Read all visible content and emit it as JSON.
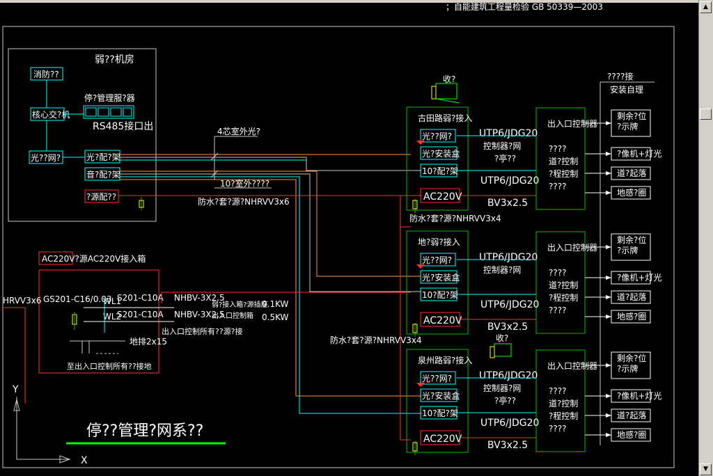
{
  "header_note": "；自能建筑工程量检验    GB  50339—2003",
  "server_room": {
    "title": "弱??机房",
    "fire": "消防??",
    "core_switch": "核心交?机",
    "mgmt_label": "停?管理服?器",
    "rs485": "RS485接口出",
    "optical": "光??网?",
    "odf": "光?配?架",
    "audio": "音?配?架",
    "power": "?源配??"
  },
  "cables": {
    "outdoor_fiber": "4芯室外光?",
    "outdoor_copper": "10?室外????",
    "nhrvv_1": "防水?套?源?NHRVV3x6",
    "nhrvv_2": "防水?套?源?NHRVV3x4",
    "nhrvv_3": "防水?套?源?NHRVV3x4"
  },
  "power_panel": {
    "title": "AC220V?源AC220V接入箱",
    "in": "HRVV3x6",
    "main_breaker": "GS201-C16/0.03",
    "b1": "S201-C10A",
    "b2": "S201-C10A",
    "w1": "WL1",
    "w2": "WL2",
    "cable1": "NHBV-3X2.5",
    "cable2": "NHBV-3X2.5",
    "load1": "弱?接入箱?源插座",
    "load2": "出入口控制箱",
    "kw1": "0.1KW",
    "kw2": "0.5KW",
    "note": "出入口控制所有??源?接",
    "ground": "地排2x15",
    "ground_note": "至出入口控制所有??接地"
  },
  "title": "停??管理?网系??",
  "axis": {
    "y": "Y",
    "x": "X"
  },
  "terminal_label": "收?",
  "top_right": {
    "label1": "????接",
    "label2": "安装自理"
  },
  "stations": [
    {
      "name": "古田路弱?接入",
      "media": "光??网?",
      "box": "光?安装盒",
      "patch": "10?配?架",
      "ac": "AC220V",
      "utp1": "UTP6/JDG20",
      "ctrl_net": "控制器?网",
      "sub": "?亭??",
      "utp2": "UTP6/JDG20",
      "bv": "BV3x2.5",
      "controller": "出入口控制器",
      "q1": "????",
      "q2": "道?控制",
      "q3": "?程控制",
      "q4": "????",
      "dev1": "剩余?位\n?示牌",
      "dev2": "?像机+灯光",
      "dev3": "道?起落",
      "dev4": "地感?圈"
    },
    {
      "name": "地?弱?接入",
      "media": "光??网?",
      "box": "光?安装盒",
      "patch": "10?配?架",
      "ac": "AC220V",
      "utp1": "UTP6/JDG20",
      "ctrl_net": "控制器?网",
      "sub": "",
      "utp2": "UTP6/JDG20",
      "bv": "BV3x2.5",
      "controller": "出入口控制器",
      "q1": "????",
      "q2": "道?控制",
      "q3": "?程控制",
      "q4": "????",
      "dev1": "剩余?位\n?示牌",
      "dev2": "?像机+灯光",
      "dev3": "道?起落",
      "dev4": "地感?圈"
    },
    {
      "name": "泉州路弱?接入",
      "media": "光??网?",
      "box": "光?安装盒",
      "patch": "10?配?架",
      "ac": "AC220V",
      "utp1": "UTP6/JDG20",
      "ctrl_net": "控制器?网",
      "sub": "?亭??",
      "utp2": "UTP6/JDG20",
      "bv": "BV3x2.5",
      "controller": "出入口控制器",
      "q1": "????",
      "q2": "道?控制",
      "q3": "?程控制",
      "q4": "????",
      "dev1": "剩余?位\n?示牌",
      "dev2": "?像机+灯光",
      "dev3": "道?起落",
      "dev4": "地感?圈"
    }
  ],
  "colors": {
    "frame": "#c8c8c8",
    "cyan": "#00ffff",
    "red": "#ff3030",
    "green": "#00c000",
    "yellow": "#ffff00",
    "orange": "#ff9a3c",
    "white_line": "#c8c8c8",
    "title_underline": "#00ff00"
  }
}
